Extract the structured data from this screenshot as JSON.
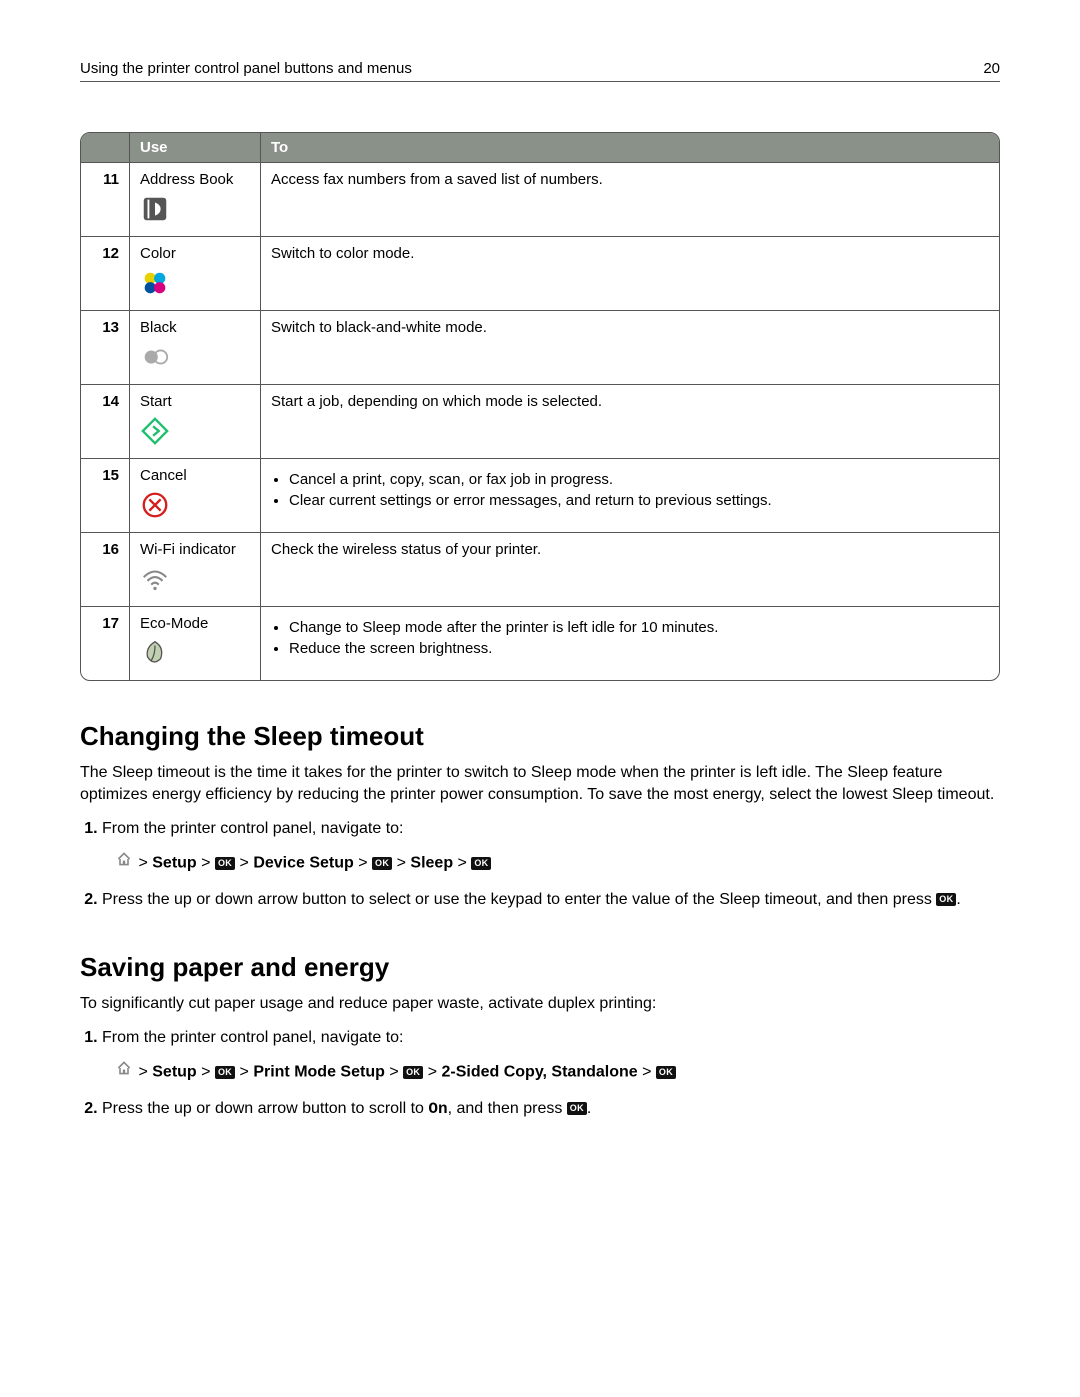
{
  "header": {
    "title": "Using the printer control panel buttons and menus",
    "page": "20"
  },
  "table": {
    "head": {
      "num": "",
      "use": "Use",
      "to": "To"
    },
    "rows": [
      {
        "num": "11",
        "use": "Address Book",
        "to": "Access fax numbers from a saved list of numbers.",
        "icon": "address-book"
      },
      {
        "num": "12",
        "use": "Color",
        "to": "Switch to color mode.",
        "icon": "color"
      },
      {
        "num": "13",
        "use": "Black",
        "to": "Switch to black-and-white mode.",
        "icon": "black"
      },
      {
        "num": "14",
        "use": "Start",
        "to": "Start a job, depending on which mode is selected.",
        "icon": "start"
      },
      {
        "num": "15",
        "use": "Cancel",
        "to_list": [
          "Cancel a print, copy, scan, or fax job in progress.",
          "Clear current settings or error messages, and return to previous settings."
        ],
        "icon": "cancel"
      },
      {
        "num": "16",
        "use": "Wi-Fi indicator",
        "to": "Check the wireless status of your printer.",
        "icon": "wifi"
      },
      {
        "num": "17",
        "use": "Eco-Mode",
        "to_list": [
          "Change to Sleep mode after the printer is left idle for 10 minutes.",
          "Reduce the screen brightness."
        ],
        "icon": "eco"
      }
    ]
  },
  "section1": {
    "heading": "Changing the Sleep timeout",
    "intro": "The Sleep timeout is the time it takes for the printer to switch to Sleep mode when the printer is left idle. The Sleep feature optimizes energy efficiency by reducing the printer power consumption. To save the most energy, select the lowest Sleep timeout.",
    "step1": "From the printer control panel, navigate to:",
    "nav": {
      "setup": "Setup",
      "device_setup": "Device Setup",
      "sleep": "Sleep"
    },
    "step2a": "Press the up or down arrow button to select or use the keypad to enter the value of the Sleep timeout, and then press ",
    "step2b": "."
  },
  "section2": {
    "heading": "Saving paper and energy",
    "intro": "To significantly cut paper usage and reduce paper waste, activate duplex printing:",
    "step1": "From the printer control panel, navigate to:",
    "nav": {
      "setup": "Setup",
      "print_mode": "Print Mode Setup",
      "twosided": "2-Sided Copy, Standalone"
    },
    "step2a": "Press the up or down arrow button to scroll to ",
    "step2_on": "On",
    "step2b": ", and then press ",
    "step2c": "."
  },
  "labels": {
    "ok": "OK",
    "gt": ">"
  }
}
